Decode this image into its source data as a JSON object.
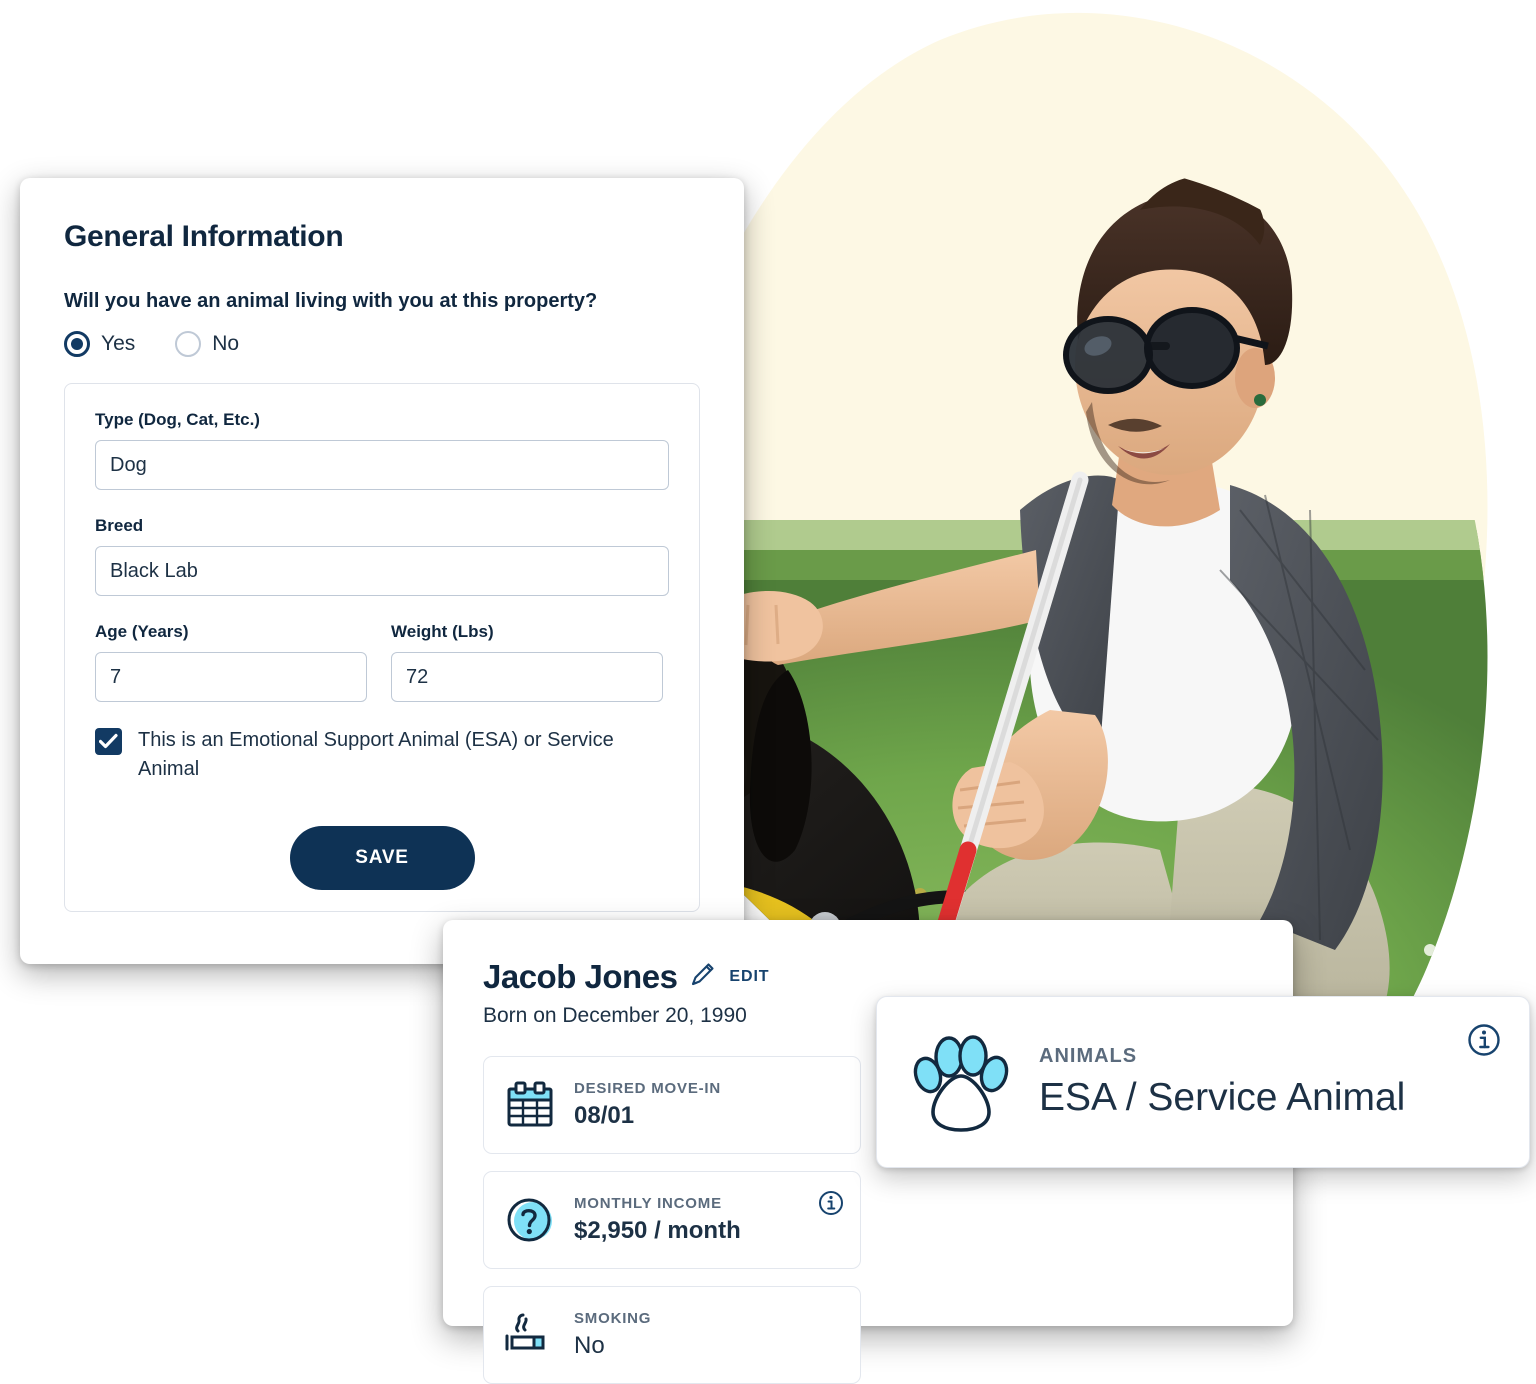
{
  "theme": {
    "navy": "#10273F",
    "button_navy": "#0E3255",
    "accent_cyan": "#7FE0F7",
    "cream_blob": "#FDF8E4",
    "muted_label": "#5B6B7D",
    "border": "#DFE3EA"
  },
  "form_card": {
    "title": "General Information",
    "question": "Will you have an animal living with you at this property?",
    "radio_options": [
      {
        "label": "Yes",
        "selected": true
      },
      {
        "label": "No",
        "selected": false
      }
    ],
    "fields": [
      {
        "label": "Type (Dog, Cat, Etc.)",
        "value": "Dog"
      },
      {
        "label": "Breed",
        "value": "Black Lab"
      },
      {
        "label": "Age (Years)",
        "value": "7"
      },
      {
        "label": "Weight (Lbs)",
        "value": "72"
      }
    ],
    "checkbox": {
      "checked": true,
      "label": "This is an Emotional Support Animal (ESA) or Service Animal"
    },
    "save_label": "SAVE"
  },
  "profile_card": {
    "name": "Jacob Jones",
    "edit_label": "EDIT",
    "born": "Born on December 20, 1990",
    "tiles": [
      {
        "icon": "calendar-icon",
        "label": "DESIRED MOVE-IN",
        "value": "08/01",
        "has_info": false
      },
      {
        "icon": "question-circle-icon",
        "label": "MONTHLY INCOME",
        "value": "$2,950 / month",
        "has_info": true
      },
      {
        "icon": "cigarette-icon",
        "label": "SMOKING",
        "value": "No",
        "has_info": false
      }
    ]
  },
  "animals_card": {
    "icon": "paw-icon",
    "label": "ANIMALS",
    "value": "ESA / Service Animal",
    "has_info": true
  },
  "photo": {
    "alt": "Man with sunglasses and white cane sitting on grass petting a black labrador service dog"
  }
}
